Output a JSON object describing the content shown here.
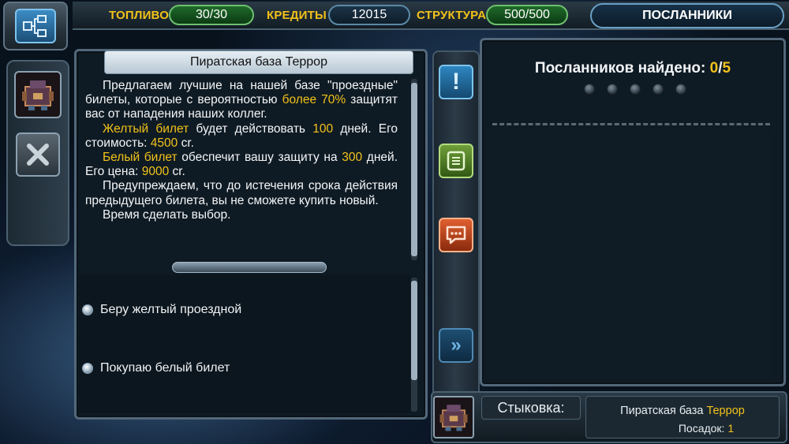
{
  "top_bar": {
    "fuel_label": "ТОПЛИВО",
    "fuel_value": "30/30",
    "credits_label": "КРЕДИТЫ",
    "credits_value": "12015",
    "structure_label": "СТРУКТУРА",
    "structure_value": "500/500",
    "envoys_tab": "ПОСЛАННИКИ"
  },
  "left_toolbar": {
    "menu_icon": "network-menu-icon",
    "avatar_icon": "pirate-base-icon",
    "close_icon": "close-icon"
  },
  "dialog": {
    "title": "Пиратская база Террор",
    "p1_a": "Предлагаем лучшие на нашей базе \"проездные\" билеты, которые с вероятностью ",
    "p1_hl": "более 70%",
    "p1_b": " защитят вас от нападения наших коллег.",
    "p2_hl": "Желтый билет",
    "p2_a": " будет действовать ",
    "p2_days": "100",
    "p2_b": " дней. Его стоимость: ",
    "p2_price": "4500",
    "p2_c": " cr.",
    "p3_hl": "Белый билет",
    "p3_a": " обеспечит вашу защиту на ",
    "p3_days": "300",
    "p3_b": " дней. Его цена: ",
    "p3_price": "9000",
    "p3_c": " cr.",
    "p4": "Предупреждаем, что до истечения срока действия предыдущего билета, вы не сможете купить новый.",
    "p5": "Время сделать выбор.",
    "options": [
      "Беру желтый проездной",
      "Покупаю белый билет"
    ]
  },
  "side_buttons": {
    "alert_icon": "exclamation-icon",
    "notes_icon": "notes-icon",
    "chat_icon": "chat-icon",
    "next_icon": "double-chevron-right-icon"
  },
  "envoys": {
    "found_label": "Посланников найдено: ",
    "found_count": "0",
    "found_sep": "/",
    "found_total": "5",
    "total_dots": 5
  },
  "docking": {
    "label": "Стыковка:",
    "base_prefix": "Пиратская база ",
    "base_name": "Террор",
    "landings_label": "Посадок: ",
    "landings_value": "1"
  },
  "colors": {
    "accent": "#f2c21a",
    "fuel_pill": "#1f6a2a",
    "panel_bg": "#0f1b24",
    "chat_button": "#c2441a",
    "notes_button": "#5a8a2a",
    "alert_button": "#2a7ab0"
  }
}
